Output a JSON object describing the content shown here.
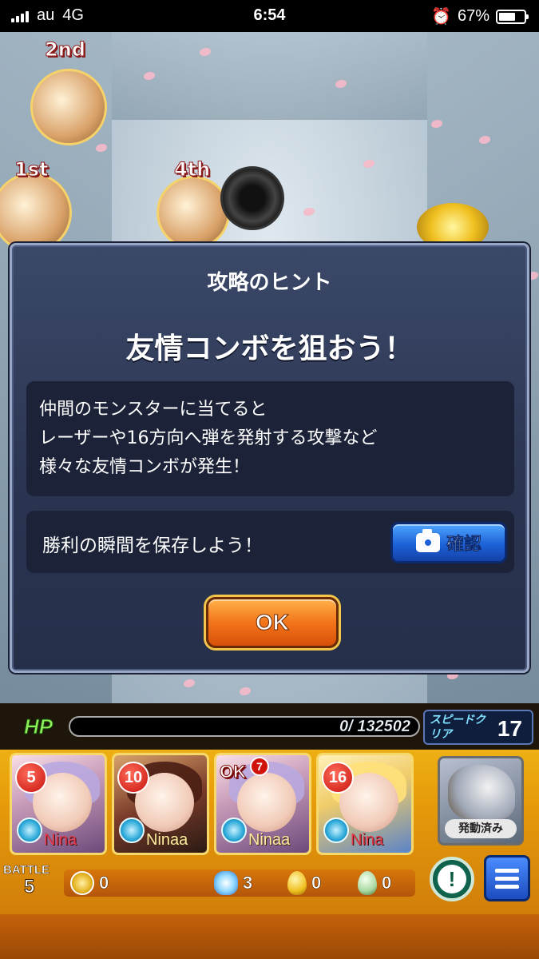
{
  "status_bar": {
    "carrier": "au",
    "network": "4G",
    "time": "6:54",
    "battery": "67%",
    "battery_level": 0.67,
    "icons": [
      "signal-icon",
      "alarm-icon",
      "battery-icon"
    ]
  },
  "field": {
    "position_labels": [
      "2nd",
      "1st",
      "4th"
    ]
  },
  "dialog": {
    "title": "攻略のヒント",
    "headline": "友情コンボを狙おう！",
    "hint_lines": [
      "仲間のモンスターに当てると",
      "レーザーや16方向へ弾を発射する攻撃など",
      "様々な友情コンボが発生！"
    ],
    "save_label": "勝利の瞬間を保存しよう！",
    "confirm_label": "確認",
    "ok_label": "OK"
  },
  "hud": {
    "hp_label": "HP",
    "hp_value": "0/ 132502",
    "speed_label": "スピードクリア",
    "speed_value": "17",
    "team": [
      {
        "turn": "5",
        "name": "Nina"
      },
      {
        "turn": "10",
        "name": "Ninaa"
      },
      {
        "turn": "OK",
        "turn_sub": "7",
        "name": "Ninaa"
      },
      {
        "turn": "16",
        "name": "Nina"
      }
    ],
    "skill_label": "発動済み",
    "battle_label": "BATTLE",
    "battle_number": "5",
    "counters": {
      "coin": "0",
      "orb": "3",
      "gold_egg": "0",
      "egg": "0"
    }
  },
  "colors": {
    "dialog_bg": "#2a3450",
    "ok_button": "#f2741a",
    "confirm_button": "#1d62d8",
    "hp_label": "#8ef05a",
    "hud_bg": "#e59a0a"
  }
}
